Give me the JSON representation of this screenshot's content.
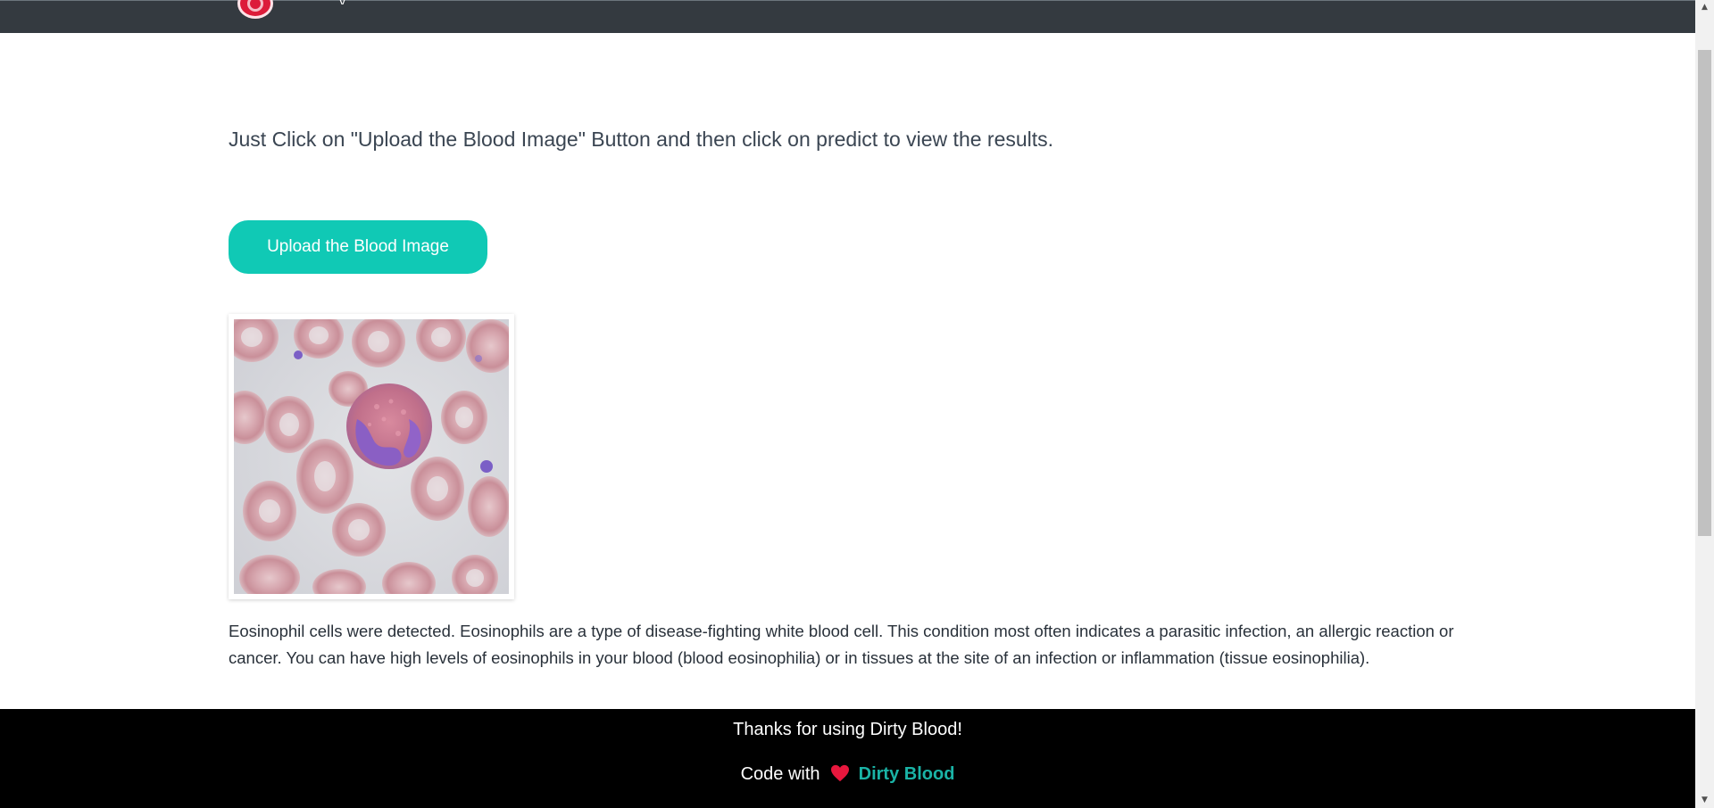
{
  "navbar": {
    "logo_icon": "blood-drop-logo-icon",
    "brand_fragment": "y"
  },
  "main": {
    "instruction": "Just Click on \"Upload the Blood Image\" Button and then click on predict to view the results.",
    "upload_button_label": "Upload the Blood Image",
    "result_text": "Eosinophil cells were detected. Eosinophils are a type of disease-fighting white blood cell. This condition most often indicates a parasitic infection, an allergic reaction or cancer. You can have high levels of eosinophils in your blood (blood eosinophilia) or in tissues at the site of an infection or inflammation (tissue eosinophilia)."
  },
  "footer": {
    "thanks": "Thanks for using Dirty Blood!",
    "credit_prefix": "Code with",
    "credit_icon": "heart-icon",
    "credit_link": "Dirty Blood"
  },
  "colors": {
    "navbar": "#343a40",
    "button": "#10c9b5",
    "footer": "#000000",
    "link": "#1ab3a6",
    "heart": "#e8173d"
  }
}
